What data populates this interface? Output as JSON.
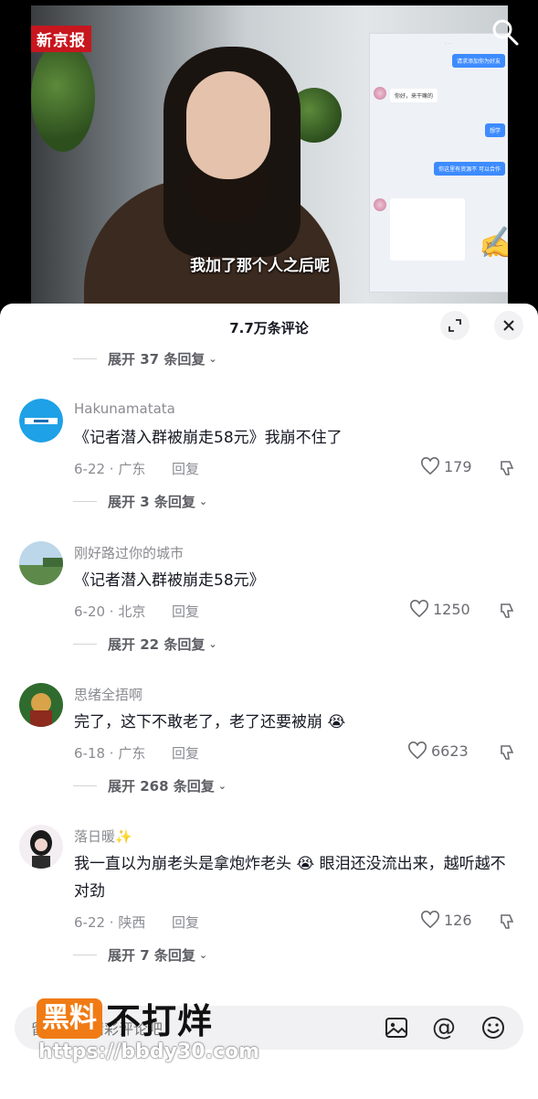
{
  "video": {
    "news_logo": "新京报",
    "subtitle": "我加了那个人之后呢",
    "chat_shot": {
      "bubble_1": "请求添加你为好友",
      "bubble_2": "你好，来干嘛的",
      "bubble_3": "想学",
      "bubble_4": "你这里有资源不 可以合作"
    }
  },
  "panel": {
    "title": "7.7万条评论"
  },
  "top_expand": {
    "label": "展开 37 条回复"
  },
  "comments": [
    {
      "username": "Hakunamatata",
      "text": "《记者潜入群被崩走58元》我崩不住了",
      "date_location": "6-22 · 广东",
      "reply_label": "回复",
      "likes": "179",
      "expand_label": "展开 3 条回复"
    },
    {
      "username": "刚好路过你的城市",
      "text": "《记者潜入群被崩走58元》",
      "date_location": "6-20 · 北京",
      "reply_label": "回复",
      "likes": "1250",
      "expand_label": "展开 22 条回复"
    },
    {
      "username": "思绪全捂啊",
      "text": "完了，这下不敢老了，老了还要被崩 😭",
      "date_location": "6-18 · 广东",
      "reply_label": "回复",
      "likes": "6623",
      "expand_label": "展开 268 条回复"
    },
    {
      "username": "落日暖✨",
      "text": "我一直以为崩老头是拿炮炸老头 😭 眼泪还没流出来，越听越不对劲",
      "date_location": "6-22 · 陕西",
      "reply_label": "回复",
      "likes": "126",
      "expand_label": "展开 7 条回复"
    }
  ],
  "input": {
    "placeholder": "留下你的精彩评论吧"
  },
  "watermark": {
    "badge": "黑料",
    "brand": "不打烊",
    "url": "https://bbdy30.com"
  },
  "colors": {
    "accent_blue": "#3d8bff",
    "watermark_orange": "#f07b14",
    "news_red": "#c8161e"
  }
}
